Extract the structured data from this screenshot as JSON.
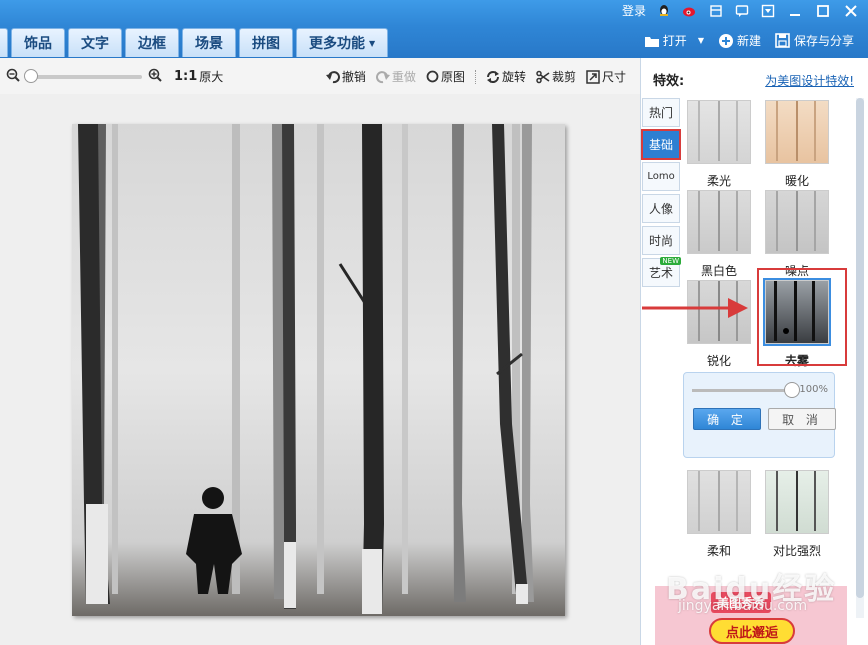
{
  "titlebar": {
    "login_label": "登录",
    "window_buttons": [
      "minimize",
      "maximize",
      "close"
    ]
  },
  "main_tabs": [
    {
      "label": "饰品"
    },
    {
      "label": "文字"
    },
    {
      "label": "边框"
    },
    {
      "label": "场景"
    },
    {
      "label": "拼图"
    },
    {
      "label": "更多功能"
    }
  ],
  "right_tools": {
    "open_label": "打开",
    "new_label": "新建",
    "save_label": "保存与分享"
  },
  "toolbar": {
    "ratio_label": "1:1",
    "original_size_label": "原大",
    "undo_label": "撤销",
    "redo_label": "重做",
    "original_label": "原图",
    "rotate_label": "旋转",
    "crop_label": "裁剪",
    "resize_label": "尺寸"
  },
  "panel": {
    "title": "特效:",
    "link": "为美图设计特效!",
    "categories": [
      {
        "label": "热门"
      },
      {
        "label": "基础",
        "selected": true
      },
      {
        "label": "Lomo"
      },
      {
        "label": "人像"
      },
      {
        "label": "时尚"
      },
      {
        "label": "艺术",
        "badge": "NEW"
      }
    ],
    "effects": [
      {
        "label": "柔光"
      },
      {
        "label": "暖化"
      },
      {
        "label": "黑白色"
      },
      {
        "label": "噪点"
      },
      {
        "label": "锐化"
      },
      {
        "label": "去雾",
        "selected": true
      },
      {
        "label": "柔和"
      },
      {
        "label": "对比强烈"
      }
    ],
    "adjust": {
      "percent": "100%",
      "confirm_label": "确 定",
      "cancel_label": "取 消"
    },
    "ad": {
      "logo": "美图秀秀",
      "button": "点此邂逅"
    }
  },
  "watermark": {
    "main": "Baidu经验",
    "url": "jingyan.baidu.com"
  }
}
